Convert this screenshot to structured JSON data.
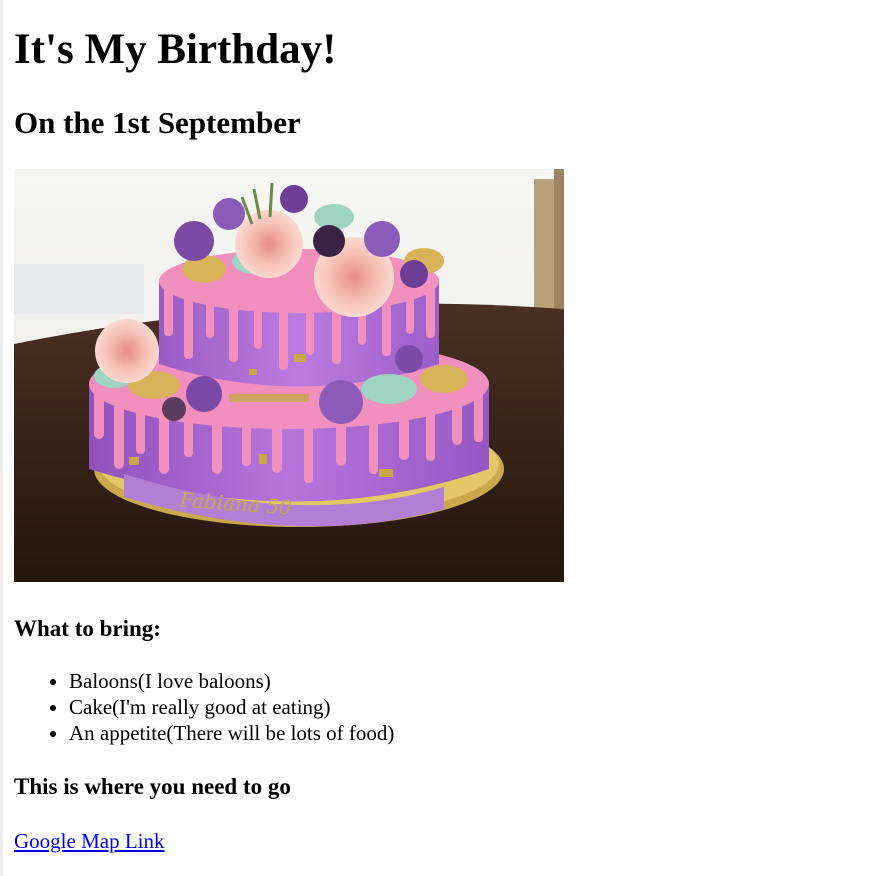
{
  "page": {
    "title": "It's My Birthday!",
    "subtitle": "On the 1st September"
  },
  "image": {
    "subject": "two-tier purple drip birthday cake with flowers and macarons",
    "plaque_text": "Fabiana 50"
  },
  "bring": {
    "heading": "What to bring:",
    "items": [
      "Baloons(I love baloons)",
      "Cake(I'm really good at eating)",
      "An appetite(There will be lots of food)"
    ]
  },
  "location": {
    "heading": "This is where you need to go",
    "link_text": "Google Map Link"
  },
  "colors": {
    "link": "#0000ee",
    "cake_purple": "#b06fd6",
    "drip_pink": "#f08cbc",
    "gold": "#c8a84a",
    "table_wood": "#3a2418"
  }
}
